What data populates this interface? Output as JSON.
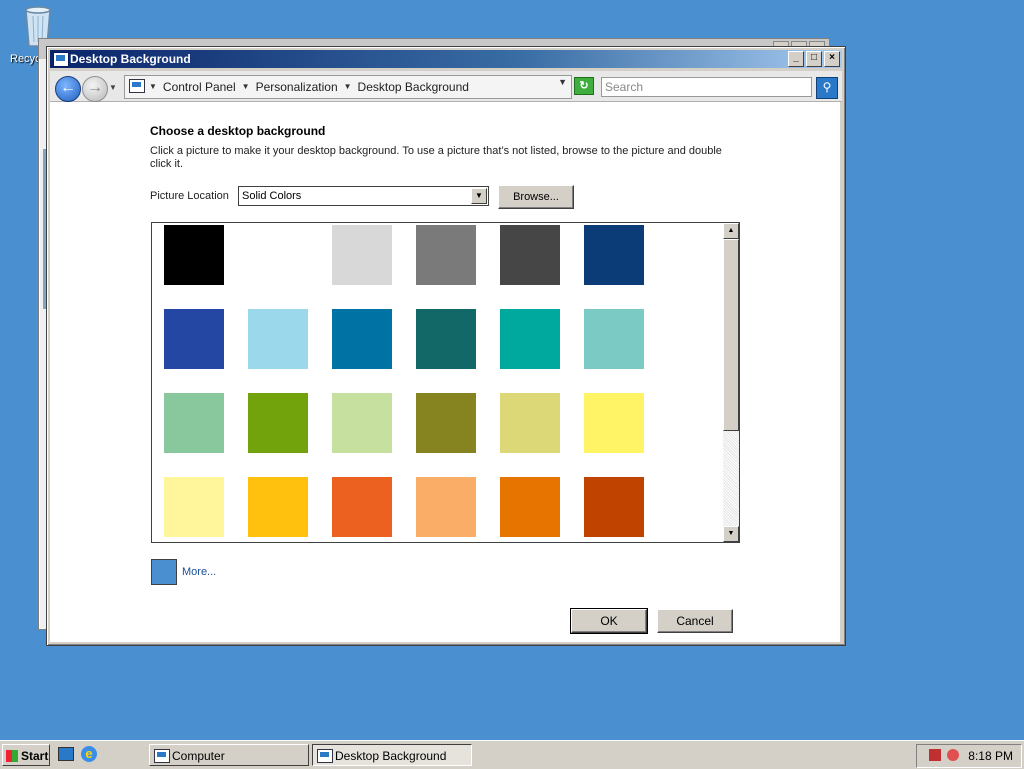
{
  "desktop": {
    "recycle_bin_label": "Recyc"
  },
  "window": {
    "title": "Desktop Background",
    "breadcrumbs": [
      "Control Panel",
      "Personalization",
      "Desktop Background"
    ],
    "search_placeholder": "Search"
  },
  "content": {
    "heading": "Choose a desktop background",
    "description": "Click a picture to make it your desktop background. To use a picture that’s not listed, browse to the picture and double click it.",
    "location_label": "Picture Location",
    "location_value": "Solid Colors",
    "browse_label": "Browse...",
    "swatches": [
      "#000000",
      "#ffffff",
      "#d8d8d8",
      "#7a7a7a",
      "#464646",
      "#0c3c78",
      "#2447a4",
      "#9cd8ec",
      "#0073a4",
      "#116866",
      "#00a99d",
      "#7ccac4",
      "#88c89c",
      "#72a20c",
      "#c6e0a0",
      "#868420",
      "#dcd878",
      "#fff366",
      "#fff59a",
      "#ffc10e",
      "#ec6020",
      "#f9ad66",
      "#e87400",
      "#c04400"
    ],
    "more_label": "More...",
    "more_color": "#4a8fd0",
    "ok_label": "OK",
    "cancel_label": "Cancel"
  },
  "taskbar": {
    "start_label": "Start",
    "tasks": [
      "Computer",
      "Desktop Background"
    ],
    "clock": "8:18 PM"
  }
}
